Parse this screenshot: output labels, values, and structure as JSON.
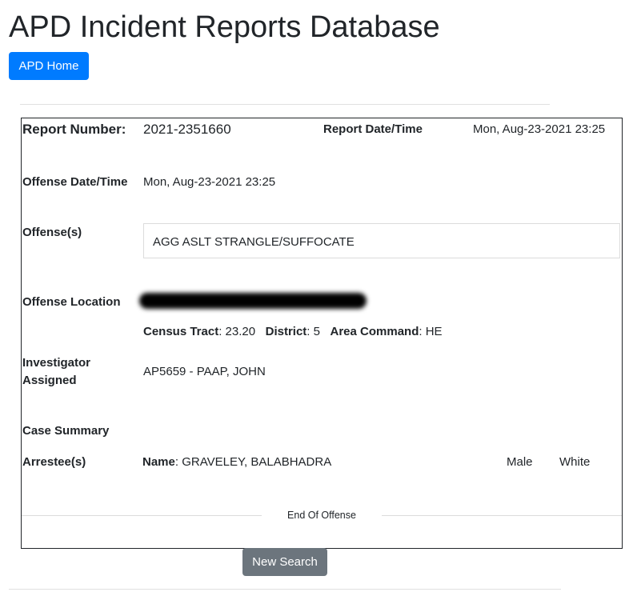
{
  "header": {
    "title": "APD Incident Reports Database",
    "home_button": "APD Home"
  },
  "report": {
    "report_number_label": "Report Number:",
    "report_number": "2021-2351660",
    "report_datetime_label": "Report Date/Time",
    "report_datetime": "Mon, Aug-23-2021 23:25",
    "offense_datetime_label": "Offense Date/Time",
    "offense_datetime": "Mon, Aug-23-2021 23:25",
    "offenses_label": "Offense(s)",
    "offense": "AGG ASLT STRANGLE/SUFFOCATE",
    "location_label": "Offense Location",
    "census_tract_label": "Census Tract",
    "census_tract": ": 23.20",
    "district_label": "District",
    "district": ": 5",
    "area_command_label": "Area Command",
    "area_command": ": HE",
    "investigator_label_1": "Investigator",
    "investigator_label_2": "Assigned",
    "investigator": "AP5659 - PAAP, JOHN",
    "case_summary_label": "Case Summary",
    "arrestees_label": "Arrestee(s)",
    "arrestee_name_label": "Name",
    "arrestee_name": ": GRAVELEY, BALABHADRA",
    "arrestee_sex": "Male",
    "arrestee_race": "White",
    "end_label": "End Of Offense"
  },
  "footer": {
    "new_search_button": "New Search"
  }
}
